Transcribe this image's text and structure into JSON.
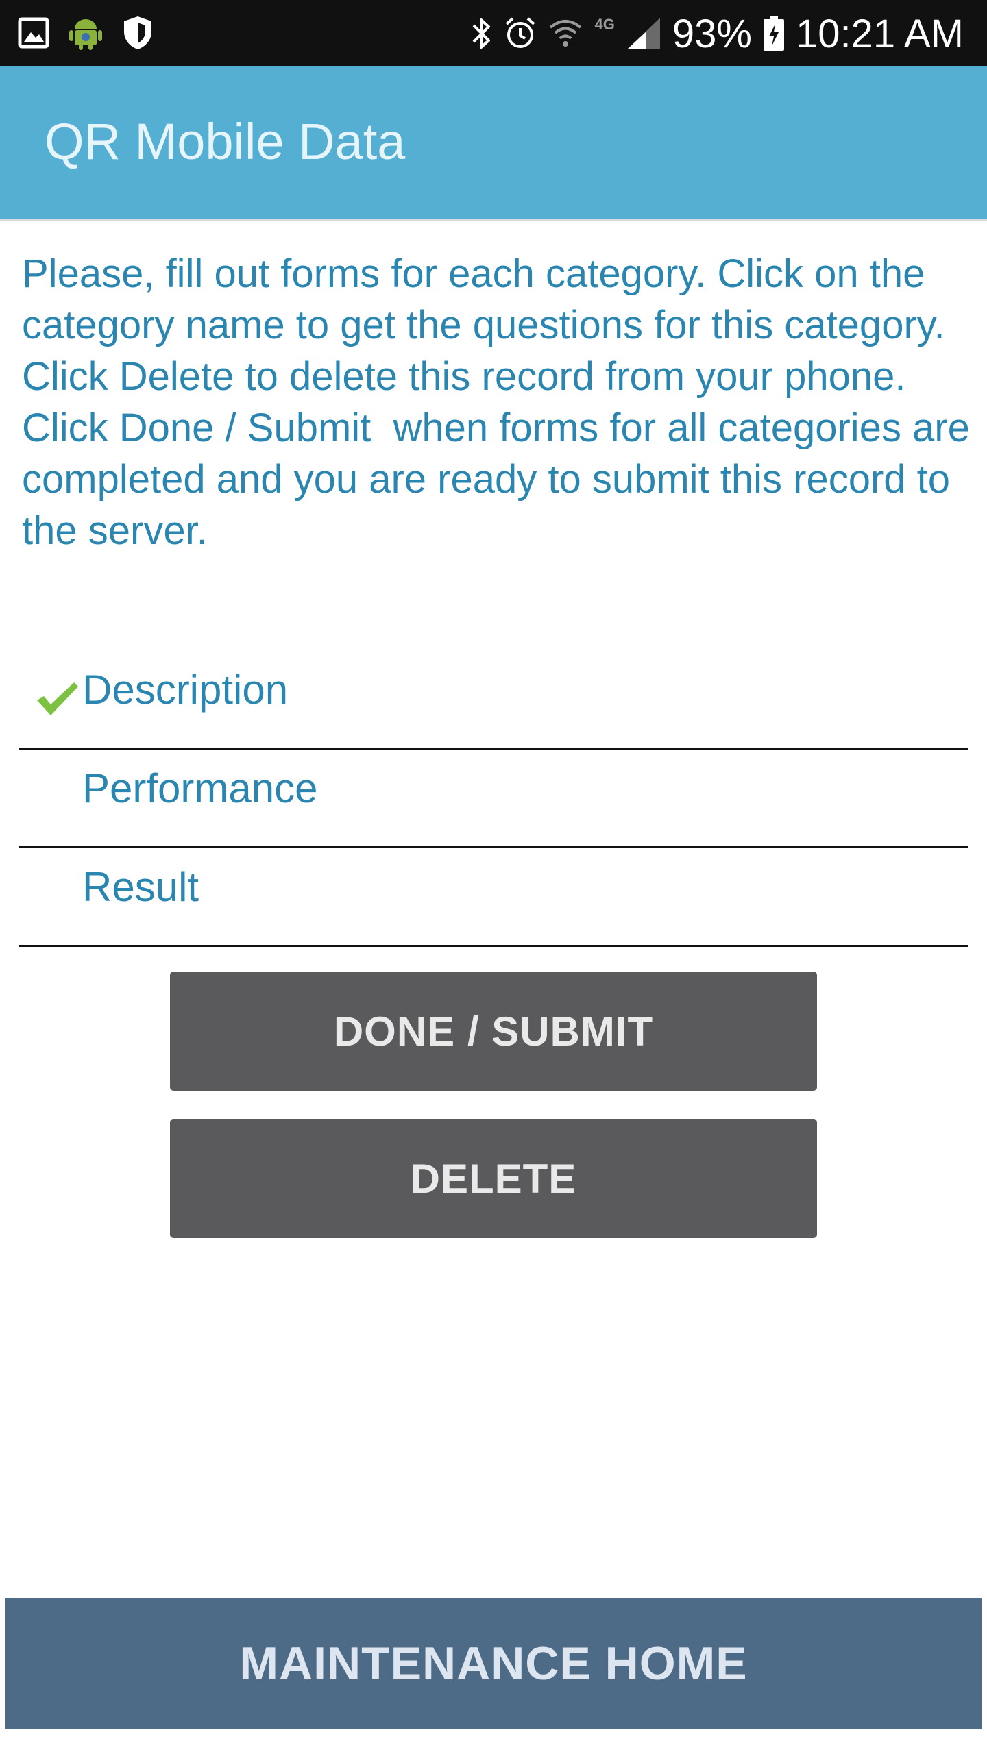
{
  "status_bar": {
    "icons_left": [
      "image-icon",
      "android-icon",
      "shield-icon"
    ],
    "icons_right": [
      "bluetooth-icon",
      "alarm-icon",
      "wifi-icon",
      "network-4g-icon",
      "signal-icon",
      "battery-icon"
    ],
    "network_label": "4G",
    "battery_percent": "93%",
    "time": "10:21 AM"
  },
  "app_bar": {
    "title": "QR Mobile Data",
    "color": "#54afd3"
  },
  "instructions": "Please, fill out forms for each category. Click on the category name to get the questions for this category. Click Delete to delete this record from your phone. Click Done / Submit  when forms for all categories are completed and you are ready to submit this record to the server.",
  "categories": [
    {
      "label": "Description",
      "completed": true
    },
    {
      "label": "Performance",
      "completed": false
    },
    {
      "label": "Result",
      "completed": false
    }
  ],
  "buttons": {
    "submit_label": "DONE / SUBMIT",
    "delete_label": "DELETE"
  },
  "bottom_bar": {
    "label": "MAINTENANCE HOME",
    "color": "#4d6a87"
  },
  "colors": {
    "text_accent": "#2a86b0",
    "button_bg": "#5a5a5c",
    "check": "#7cc142"
  }
}
